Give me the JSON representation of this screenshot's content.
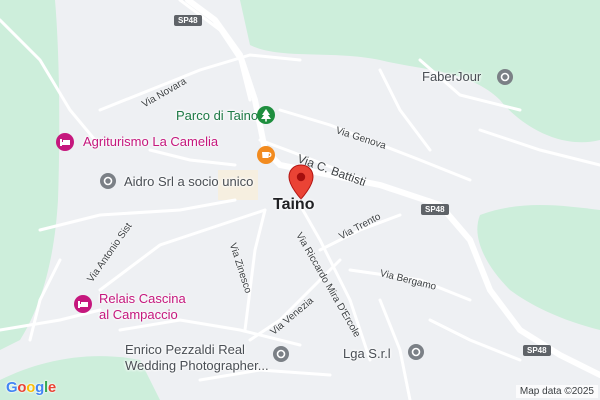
{
  "map": {
    "town": "Taino",
    "roads": {
      "sp48_top": "SP48",
      "sp48_mid": "SP48",
      "sp48_bottom": "SP48",
      "via_novara": "Via Novara",
      "via_genova": "Via Genova",
      "via_c_battisti": "Via C. Battisti",
      "via_antonio_sist": "Via Antonio Sist",
      "via_zinesco": "Via Zinesco",
      "via_riccardo": "Via Riccardo Mira D'Ercole",
      "via_trento": "Via Trento",
      "via_bergamo": "Via Bergamo",
      "via_venezia": "Via Venezia"
    },
    "pois": {
      "faberjour": "FaberJour",
      "parco": "Parco di Taino",
      "agriturismo": "Agriturismo La Camelia",
      "aidro": "Aidro Srl a socio unico",
      "relais_l1": "Relais Cascina",
      "relais_l2": "al Campaccio",
      "enrico_l1": "Enrico Pezzaldi Real",
      "enrico_l2": "Wedding Photographer...",
      "lga": "Lga S.r.l"
    },
    "footer": {
      "attribution": "Map data ©2025",
      "logo_letters": [
        "G",
        "o",
        "o",
        "g",
        "l",
        "e"
      ]
    },
    "colors": {
      "land": "#eef0f3",
      "forest": "#cdeedb",
      "road": "#ffffff",
      "marker": "#ea4335",
      "poi_pink": "#c5177d",
      "poi_gray": "#7b8086",
      "park": "#1e8e3e",
      "cafe": "#f28b1f"
    },
    "icons": {
      "marker": "red-location-pin",
      "hotel": "bed-icon",
      "business": "generic-pin-icon",
      "park": "tree-icon",
      "cafe": "coffee-cup-icon"
    }
  }
}
